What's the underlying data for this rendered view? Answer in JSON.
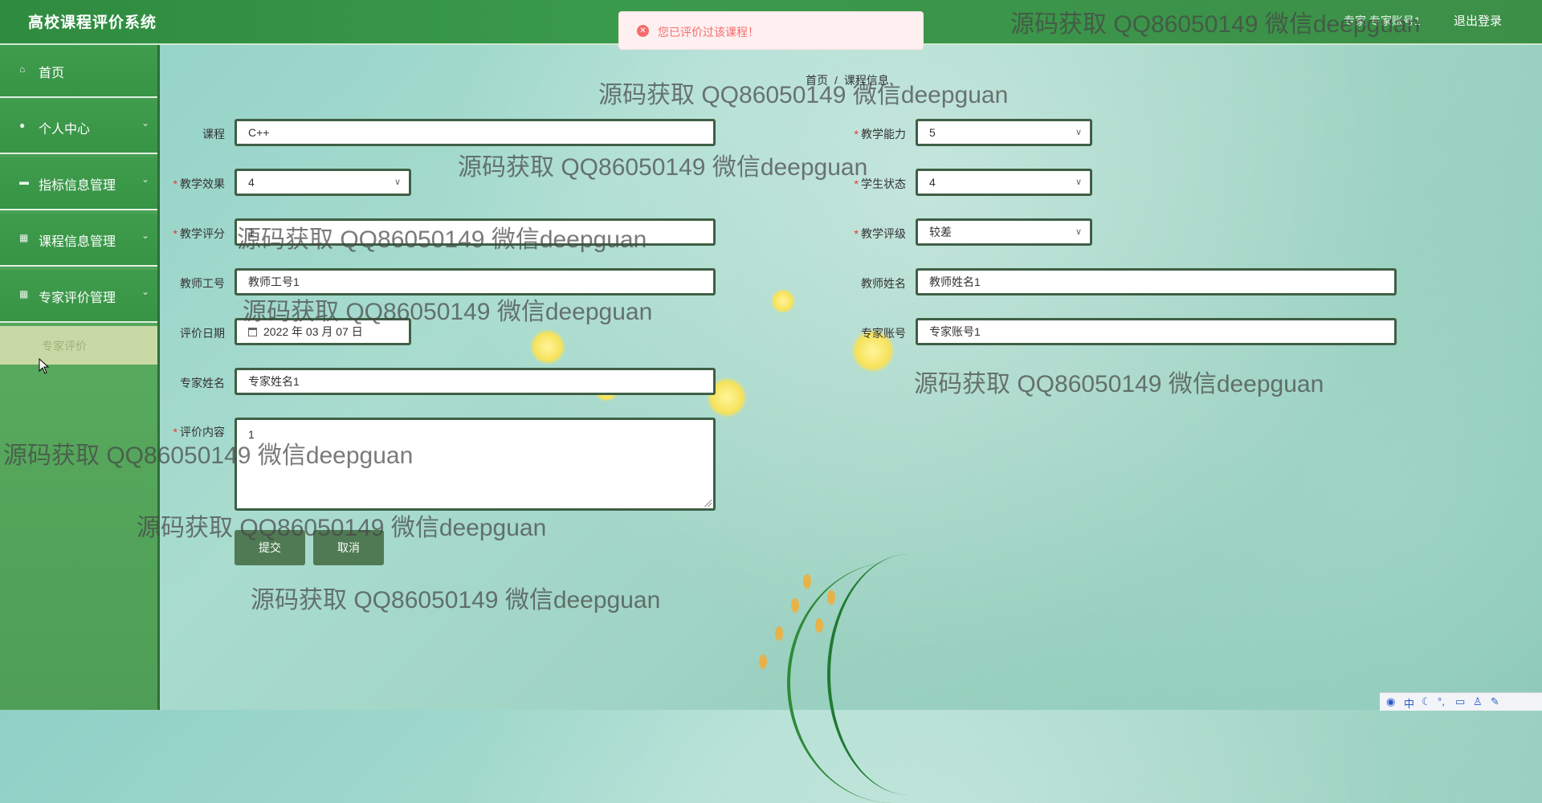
{
  "app": {
    "title": "高校课程评价系统"
  },
  "header": {
    "user_text": "专家 专家账号1",
    "logout_label": "退出登录"
  },
  "toast": {
    "message": "您已评价过该课程！",
    "type": "error"
  },
  "sidebar": {
    "items": [
      {
        "label": "首页",
        "icon": "home-icon",
        "expandable": false
      },
      {
        "label": "个人中心",
        "icon": "user-icon",
        "expandable": true
      },
      {
        "label": "指标信息管理",
        "icon": "chat-icon",
        "expandable": true
      },
      {
        "label": "课程信息管理",
        "icon": "grid-icon",
        "expandable": true
      },
      {
        "label": "专家评价管理",
        "icon": "grid-icon",
        "expandable": true
      }
    ],
    "submenu": [
      {
        "label": "专家评价"
      }
    ]
  },
  "breadcrumb": {
    "home": "首页",
    "separator": "/",
    "current": "课程信息"
  },
  "form": {
    "course": {
      "label": "课程",
      "value": "C++",
      "required": false
    },
    "teaching_ability": {
      "label": "教学能力",
      "value": "5",
      "required": true
    },
    "teaching_effect": {
      "label": "教学效果",
      "value": "4",
      "required": true
    },
    "student_state": {
      "label": "学生状态",
      "value": "4",
      "required": true
    },
    "teaching_score": {
      "label": "教学评分",
      "value": "1",
      "required": true
    },
    "teaching_grade": {
      "label": "教学评级",
      "value": "较差",
      "required": true
    },
    "teacher_id": {
      "label": "教师工号",
      "value": "教师工号1",
      "required": false
    },
    "teacher_name": {
      "label": "教师姓名",
      "value": "教师姓名1",
      "required": false
    },
    "eval_date": {
      "label": "评价日期",
      "value": "2022 年 03 月 07 日",
      "required": false
    },
    "expert_account": {
      "label": "专家账号",
      "value": "专家账号1",
      "required": false
    },
    "expert_name": {
      "label": "专家姓名",
      "value": "专家姓名1",
      "required": false
    },
    "comment": {
      "label": "评价内容",
      "value": "1",
      "required": true
    }
  },
  "buttons": {
    "submit": "提交",
    "cancel": "取消"
  },
  "watermark": {
    "text": "源码获取 QQ86050149 微信deepguan"
  },
  "ime": {
    "lang": "中"
  },
  "colors": {
    "header": "#3a9a4c",
    "sidebar": "#3f9c4d",
    "button": "#4f7a53",
    "required": "#ee3333",
    "toast_text": "#f56c6c"
  }
}
